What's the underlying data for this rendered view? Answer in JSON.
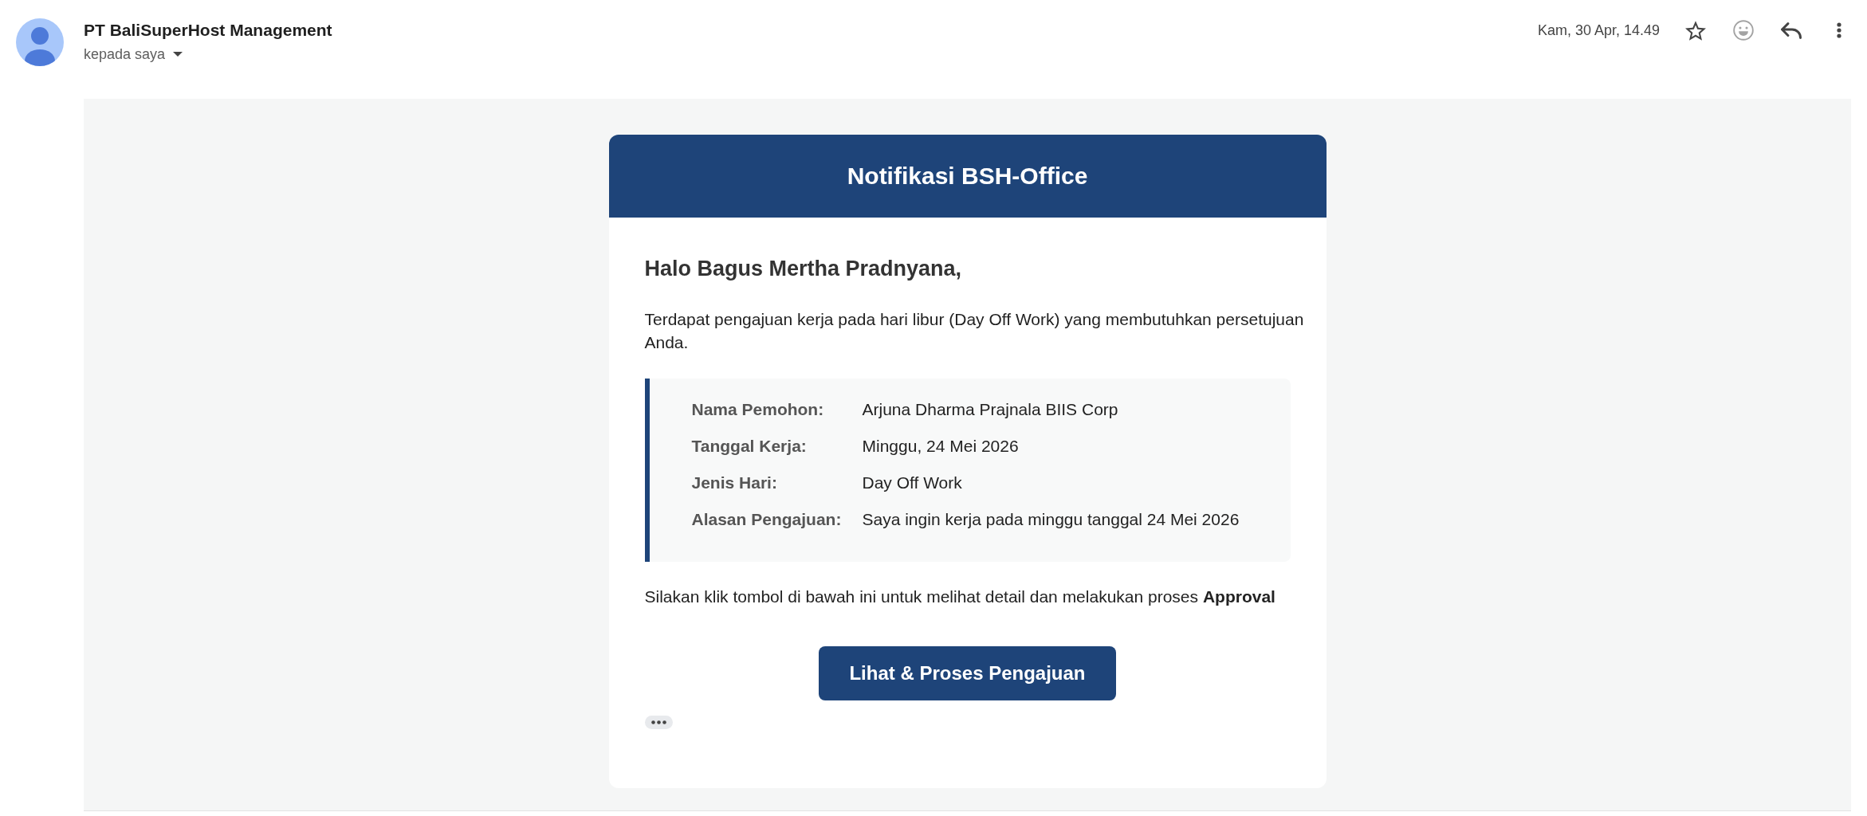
{
  "sender": {
    "name": "PT BaliSuperHost Management",
    "recipient": "kepada saya"
  },
  "message": {
    "date": "Kam, 30 Apr, 14.49"
  },
  "email": {
    "title": "Notifikasi BSH-Office",
    "greeting": "Halo Bagus Mertha Pradnyana,",
    "intro": "Terdapat pengajuan kerja pada hari libur (Day Off Work) yang membutuhkan persetujuan Anda.",
    "details": [
      {
        "label": "Nama Pemohon:",
        "value": "Arjuna Dharma Prajnala BIIS Corp"
      },
      {
        "label": "Tanggal Kerja:",
        "value": "Minggu, 24 Mei 2026"
      },
      {
        "label": "Jenis Hari:",
        "value": "Day Off Work"
      },
      {
        "label": "Alasan Pengajuan:",
        "value": "Saya ingin kerja pada minggu tanggal 24 Mei 2026"
      }
    ],
    "instruction": "Silakan klik tombol di bawah ini untuk melihat detail dan melakukan proses **Approval**",
    "button": "Lihat & Proses Pengajuan"
  }
}
